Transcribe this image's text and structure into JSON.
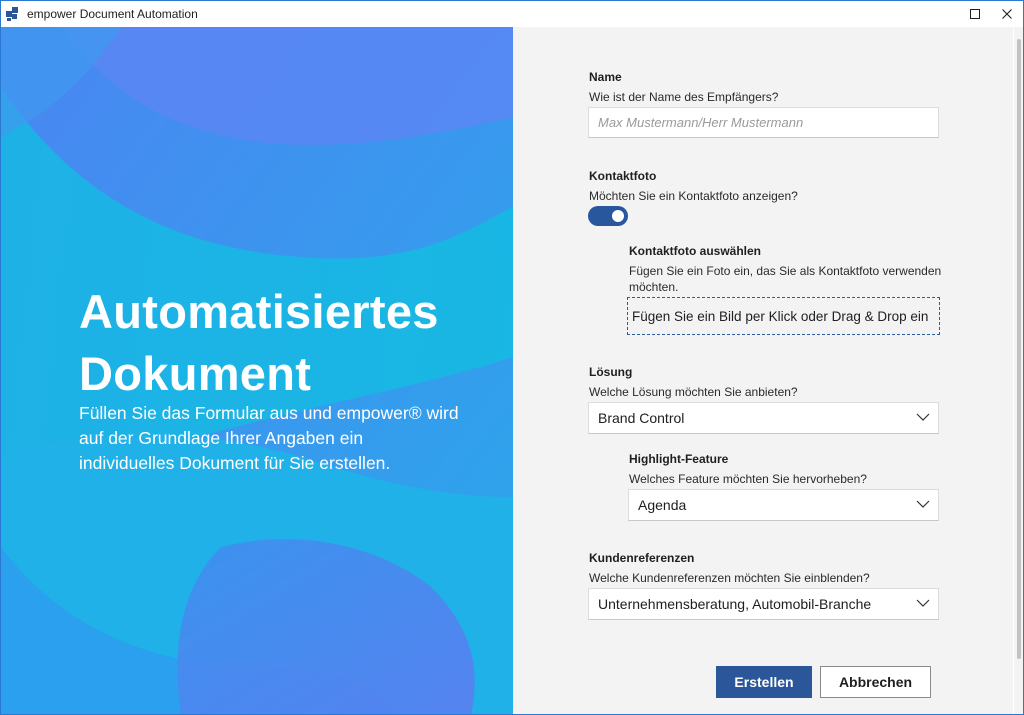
{
  "window": {
    "title": "empower Document Automation"
  },
  "hero": {
    "title_line1": "Automatisiertes",
    "title_line2": "Dokument",
    "description": "Füllen Sie das Formular aus und empower® wird auf der Grundlage Ihrer Angaben ein individuelles Dokument für Sie erstellen."
  },
  "form": {
    "name": {
      "label": "Name",
      "help": "Wie ist der Name des Empfängers?",
      "placeholder": "Max Mustermann/Herr Mustermann",
      "value": ""
    },
    "contact_photo": {
      "label": "Kontaktfoto",
      "help": "Möchten Sie ein Kontaktfoto anzeigen?",
      "toggle_on": true
    },
    "contact_photo_select": {
      "label": "Kontaktfoto auswählen",
      "help": "Fügen Sie ein Foto ein, das Sie als Kontaktfoto verwenden möchten.",
      "dropzone_text": "Fügen Sie ein Bild per Klick oder Drag & Drop ein"
    },
    "solution": {
      "label": "Lösung",
      "help": "Welche Lösung möchten Sie anbieten?",
      "selected": "Brand Control"
    },
    "highlight_feature": {
      "label": "Highlight-Feature",
      "help": "Welches Feature möchten Sie hervorheben?",
      "selected": "Agenda"
    },
    "customer_references": {
      "label": "Kundenreferenzen",
      "help": "Welche Kundenreferenzen möchten Sie einblenden?",
      "selected": "Unternehmensberatung, Automobil-Branche"
    },
    "buttons": {
      "create": "Erstellen",
      "cancel": "Abbrechen"
    }
  },
  "colors": {
    "accent": "#2b579a",
    "hero_blue": "#22a4ea",
    "form_bg": "#f3f3f3"
  },
  "icons": {
    "app": "empower-logo-icon",
    "maximize": "maximize-icon",
    "close": "close-icon",
    "dropdown": "chevron-down-icon"
  }
}
